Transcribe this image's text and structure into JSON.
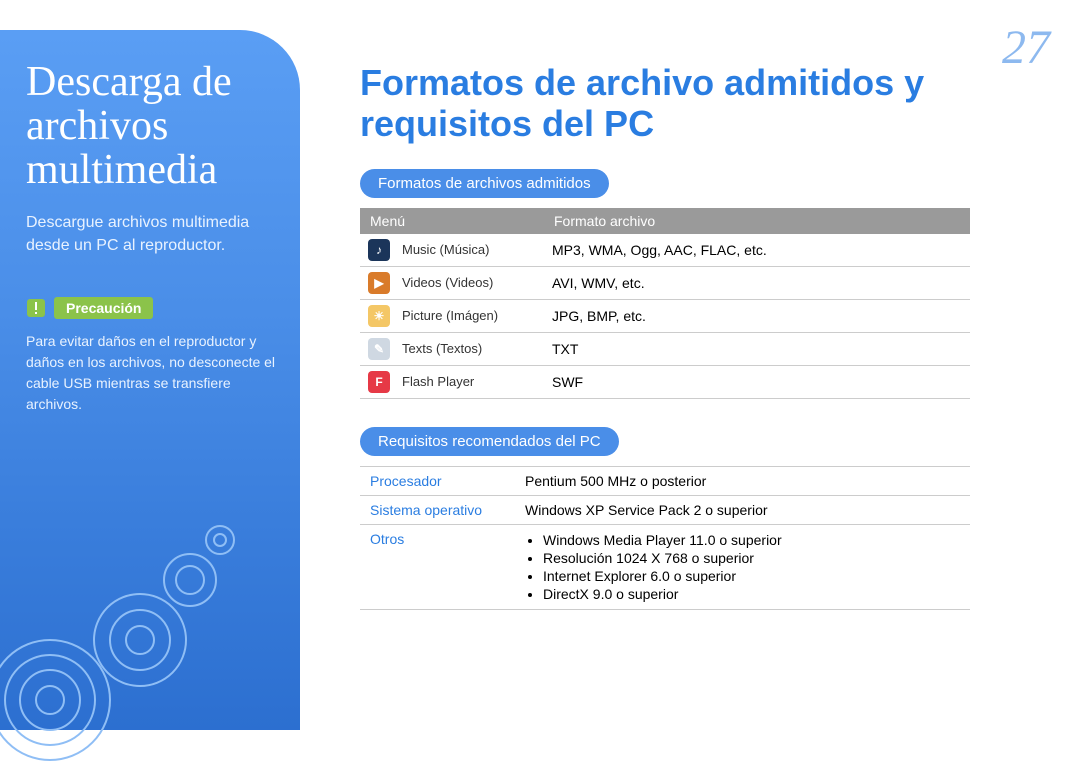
{
  "page_number": "27",
  "sidebar": {
    "title": "Descarga de archivos multimedia",
    "subtitle": "Descargue archivos multimedia desde un PC al reproductor.",
    "caution_label": "Precaución",
    "caution_text": "Para evitar daños en el reproductor y daños en los archivos, no desconecte el cable USB mientras se transfiere archivos."
  },
  "main": {
    "title": "Formatos de archivo admitidos y requisitos del PC",
    "formats_heading": "Formatos de archivos admitidos",
    "formats_table": {
      "headers": {
        "menu": "Menú",
        "format": "Formato archivo"
      },
      "rows": [
        {
          "icon": "music",
          "menu": "Music (Música)",
          "format": "MP3, WMA, Ogg, AAC, FLAC, etc."
        },
        {
          "icon": "video",
          "menu": "Videos (Videos)",
          "format": "AVI, WMV, etc."
        },
        {
          "icon": "picture",
          "menu": "Picture (Imágen)",
          "format": "JPG, BMP, etc."
        },
        {
          "icon": "text",
          "menu": "Texts (Textos)",
          "format": "TXT"
        },
        {
          "icon": "flash",
          "menu": "Flash Player",
          "format": "SWF"
        }
      ]
    },
    "requirements_heading": "Requisitos recomendados del PC",
    "requirements": [
      {
        "label": "Procesador",
        "value": "Pentium 500 MHz o posterior"
      },
      {
        "label": "Sistema operativo",
        "value": "Windows XP Service Pack 2 o superior"
      },
      {
        "label": "Otros",
        "items": [
          "Windows Media Player 11.0 o superior",
          "Resolución 1024 X 768 o superior",
          "Internet Explorer 6.0 o superior",
          "DirectX 9.0 o superior"
        ]
      }
    ]
  },
  "icons": {
    "music": {
      "bg": "#1b355a",
      "glyph": "♪"
    },
    "video": {
      "bg": "#d97b2a",
      "glyph": "▶"
    },
    "picture": {
      "bg": "#f4c766",
      "glyph": "☀"
    },
    "text": {
      "bg": "#cfd8e2",
      "glyph": "✎"
    },
    "flash": {
      "bg": "#e63946",
      "glyph": "F"
    }
  }
}
